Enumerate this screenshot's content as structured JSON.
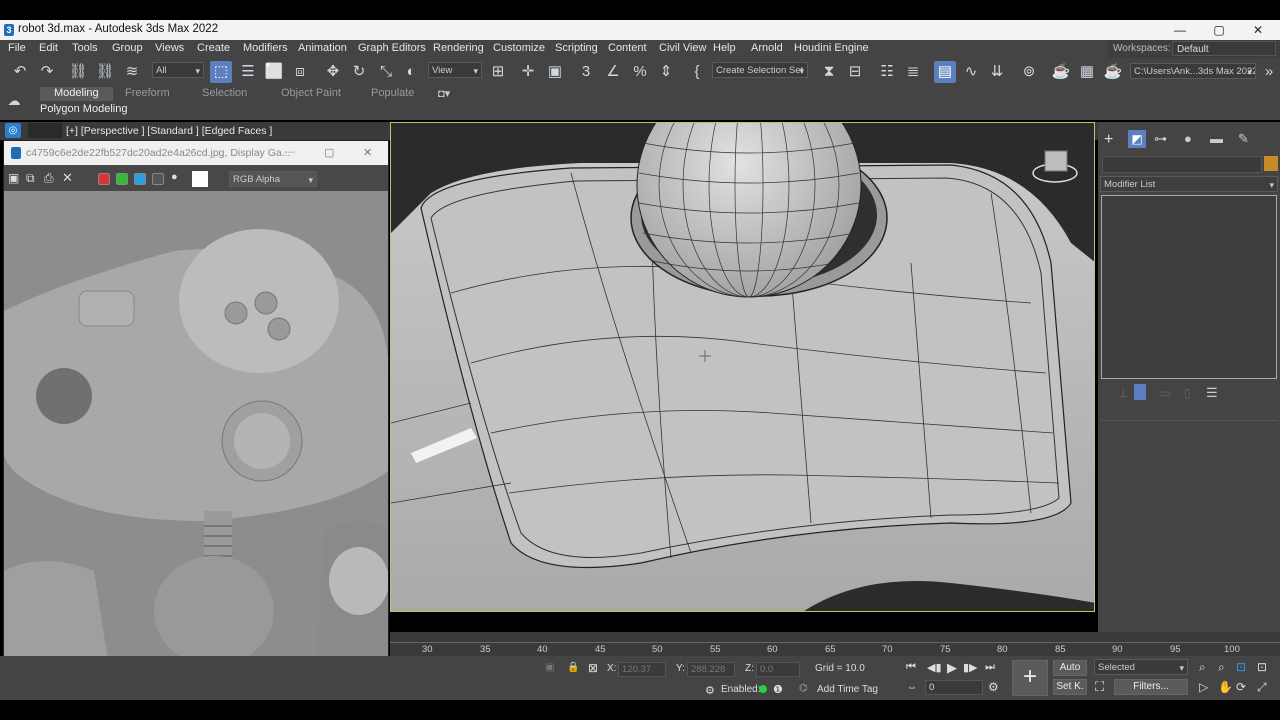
{
  "window": {
    "title": "robot 3d.max - Autodesk 3ds Max 2022",
    "controls": {
      "minimize": "—",
      "maximize": "▢",
      "close": "✕"
    }
  },
  "menu": {
    "items": [
      "File",
      "Edit",
      "Tools",
      "Group",
      "Views",
      "Create",
      "Modifiers",
      "Animation",
      "Graph Editors",
      "Rendering",
      "Customize",
      "Scripting",
      "Content",
      "Civil View",
      "Help",
      "Arnold",
      "Houdini Engine"
    ],
    "workspaces_label": "Workspaces:",
    "workspaces_value": "Default"
  },
  "toolbar": {
    "selection_filter": "All",
    "reference_coord": "View",
    "selection_set": "Create Selection Set",
    "project_path": "C:\\Users\\Ank...3ds Max 2022"
  },
  "ribbon": {
    "tabs": [
      "Modeling",
      "Freeform",
      "Selection",
      "Object Paint",
      "Populate"
    ],
    "active_tab": "Modeling",
    "panel_label": "Polygon Modeling"
  },
  "viewport": {
    "label": "[+] [Perspective ] [Standard ] [Edged Faces ]"
  },
  "image_window": {
    "title": "c4759c6e2de22fb527dc20ad2e4a26cd.jpg, Display Ga...",
    "channel": "RGB Alpha",
    "controls": {
      "minimize": "—",
      "maximize": "▢",
      "close": "✕"
    }
  },
  "command_panel": {
    "modifier_list": "Modifier List"
  },
  "timeline": {
    "ticks": [
      "30",
      "35",
      "40",
      "45",
      "50",
      "55",
      "60",
      "65",
      "70",
      "75",
      "80",
      "85",
      "90",
      "95",
      "100"
    ]
  },
  "status": {
    "x_label": "X:",
    "x_value": "120.37",
    "y_label": "Y:",
    "y_value": "288.228",
    "z_label": "Z:",
    "z_value": "0.0",
    "grid": "Grid = 10.0",
    "enabled_label": "Enabled:",
    "add_time_tag": "Add Time Tag",
    "auto": "Auto",
    "set_key": "Set K.",
    "selected": "Selected",
    "filters": "Filters...",
    "frame": "0"
  }
}
